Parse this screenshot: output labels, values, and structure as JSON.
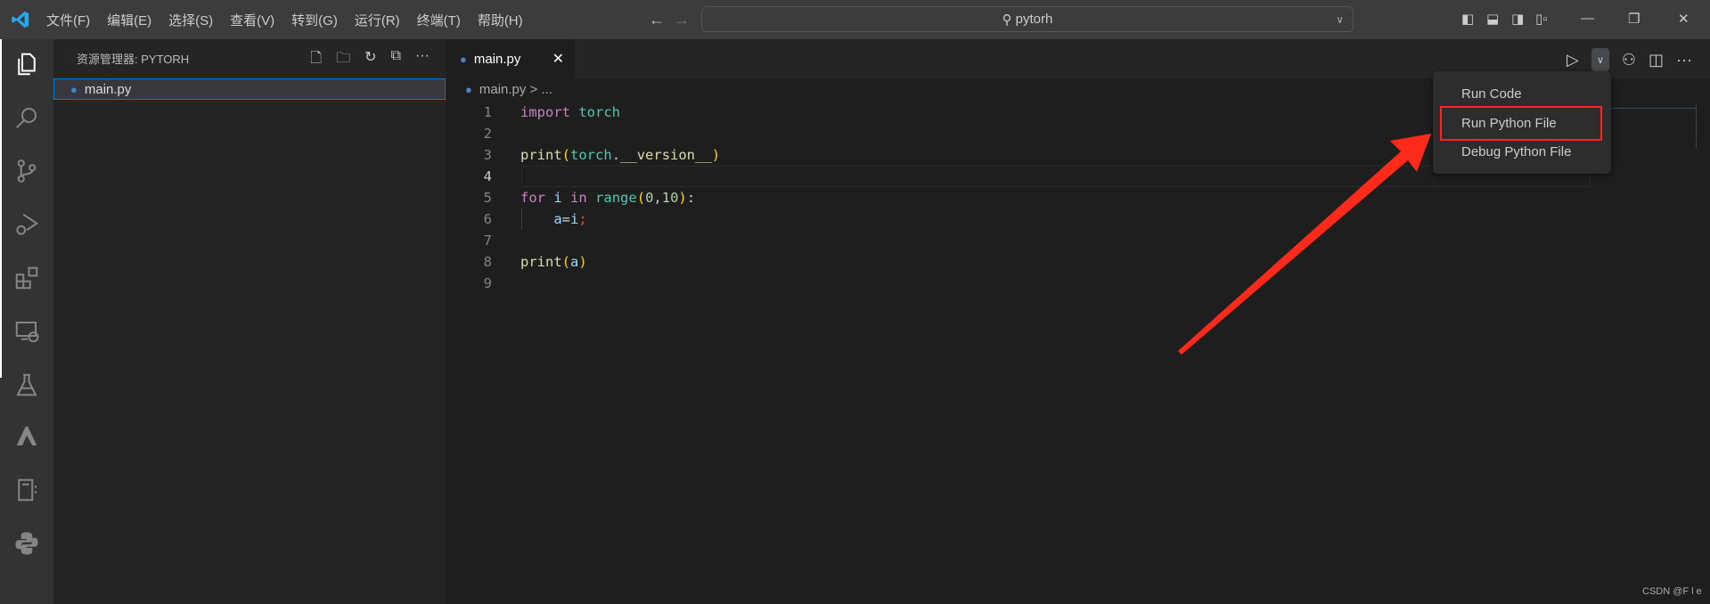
{
  "titlebar": {
    "menu": [
      "文件(F)",
      "编辑(E)",
      "选择(S)",
      "查看(V)",
      "转到(G)",
      "运行(R)",
      "终端(T)",
      "帮助(H)"
    ],
    "search": "pytorh"
  },
  "sidebar": {
    "title": "资源管理器: PYTORH",
    "files": [
      "main.py"
    ]
  },
  "editor": {
    "tab": "main.py",
    "breadcrumb": "main.py > ...",
    "line_numbers": [
      "1",
      "2",
      "3",
      "4",
      "5",
      "6",
      "7",
      "8",
      "9"
    ],
    "current_line": "4"
  },
  "run_menu": {
    "items": [
      "Run Code",
      "Run Python File",
      "Debug Python File"
    ],
    "highlighted": "Run Python File"
  },
  "annotation_color": "#ff2a1a",
  "watermark": "CSDN @F l e"
}
